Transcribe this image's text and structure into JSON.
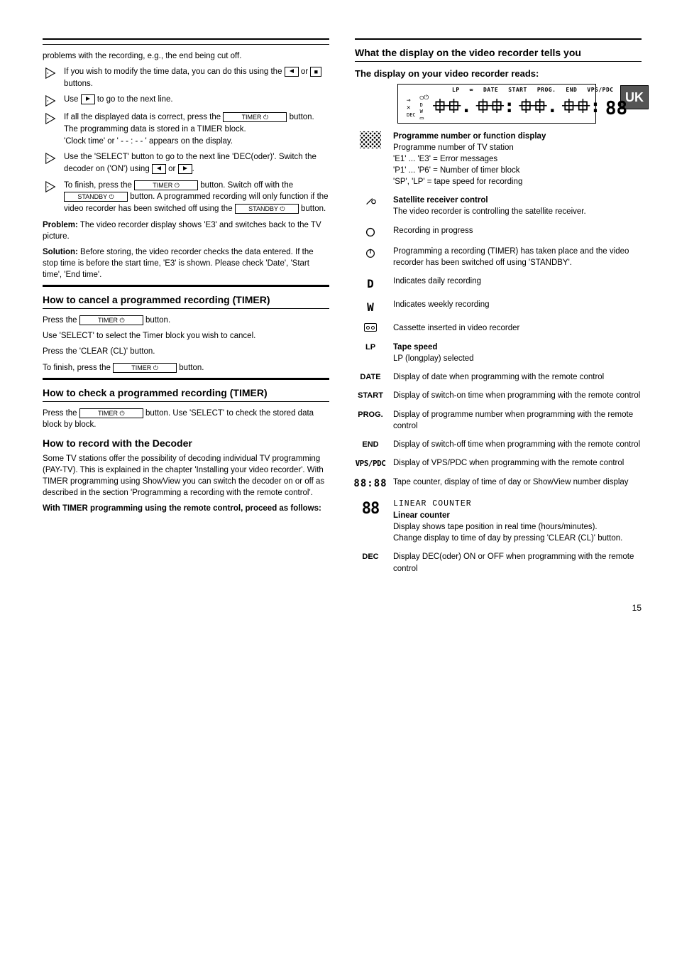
{
  "region_badge": "UK",
  "page_number": "15",
  "left": {
    "intro_continue": "problems with the recording, e.g., the end being cut off.",
    "steps": [
      {
        "title": "If you wish to modify the time data, you can do this using the ",
        "key1_label": "■",
        "title_mid": " or ",
        "key2_label": "",
        "title_end": " buttons.",
        "extra1": "",
        "extra2": "Use  to go to the next line."
      },
      {
        "title": "If all the displayed data is correct, press the ",
        "key": "TIMER ⏻",
        "title_end": " button. The programming data is stored in a TIMER block.",
        "extra": "'Clock time' or ' - - : - - ' appears on the display."
      },
      {
        "title": "Use the 'SELECT' button to go to the next line 'DEC(oder)'. Switch the decoder on ('ON') using  or .",
        "title_end": ""
      },
      {
        "title": "To finish, press the ",
        "key": "TIMER ⏻",
        "title_end": " button. Switch off with the ",
        "key2": "STANDBY ⏻",
        "title2_end": " button. A programmed recording will only function if the video recorder has been switched off using the ",
        "key3": "STANDBY ⏻",
        "title3_end": " button."
      }
    ],
    "problem_title": "Problem:",
    "problem_text": "The video recorder display shows 'E3' and switches back to the TV picture.",
    "solution_title": "Solution:",
    "solution_text": "Before storing, the video recorder checks the data entered. If the stop time is before the start time, 'E3' is shown. Please check 'Date', 'Start time', 'End time'.",
    "cancel_heading": "How to cancel a programmed recording (TIMER)",
    "cancel_steps": [
      "Press the  TIMER ⏻  button.",
      "Use 'SELECT' to select the Timer block you wish to cancel.",
      "Press the 'CLEAR (CL)' button.",
      "To finish, press the  TIMER ⏻  button."
    ],
    "check_heading": "How to check a programmed recording (TIMER)",
    "check_intro": "Press the  TIMER ⏻  button. Use 'SELECT' to check the stored data block by block.",
    "dec_heading": "How to record with the Decoder",
    "dec_text": "Some TV stations offer the possibility of decoding individual TV programming (PAY-TV). This is explained in the chapter 'Installing your video recorder'. With TIMER programming using ShowView you can switch the decoder on or off as described in the section 'Programming a recording with the remote control'.",
    "dec_steps_heading": "With TIMER programming using the remote control, proceed as follows:"
  },
  "right": {
    "display_heading": "What the display on the video recorder tells you",
    "display_sub": "The display on your video recorder reads:",
    "labels_row": [
      "LP",
      "∞",
      "DATE",
      "START",
      "PROG.",
      "END",
      "VPS/PDC"
    ],
    "items": [
      {
        "icon": "dot-grid",
        "title": "Programme number or function display",
        "lines": [
          "Programme number of TV station",
          "'E1' ... 'E3' = Error messages",
          "'P1' ... 'P6' = Number of timer block",
          "'SP', 'LP' = tape speed for recording"
        ]
      },
      {
        "icon": "sat",
        "title": "Satellite receiver control",
        "lines": [
          "The video recorder is controlling the satellite receiver."
        ]
      },
      {
        "icon": "rec-circle",
        "title": "",
        "lines": [
          "Recording in progress"
        ]
      },
      {
        "icon": "timer-circle",
        "title": "",
        "lines": [
          "Programming a recording (TIMER) has taken place and the video recorder has been switched off using 'STANDBY'."
        ]
      },
      {
        "icon": "letter-D",
        "title": "",
        "lines": [
          "Indicates daily recording"
        ]
      },
      {
        "icon": "letter-W",
        "title": "",
        "lines": [
          "Indicates weekly recording"
        ]
      },
      {
        "icon": "cassette",
        "title": "",
        "lines": [
          "Cassette inserted in video recorder"
        ]
      },
      {
        "icon": "text-LP",
        "title": "Tape speed",
        "lines": [
          "LP (longplay) selected"
        ]
      },
      {
        "icon": "text-DATE",
        "title": "",
        "lines": [
          "Display of date when programming with the remote control"
        ]
      },
      {
        "icon": "text-START",
        "title": "",
        "lines": [
          "Display of switch-on time when programming with the remote control"
        ]
      },
      {
        "icon": "text-PROG",
        "title": "",
        "lines": [
          "Display of programme number when programming with the remote control"
        ]
      },
      {
        "icon": "text-END",
        "title": "",
        "lines": [
          "Display of switch-off time when programming with the remote control"
        ]
      },
      {
        "icon": "text-VPS",
        "title": "",
        "lines": [
          "Display of VPS/PDC when programming with the remote control"
        ]
      },
      {
        "icon": "seg-time",
        "title": "",
        "lines": [
          "Tape counter, display of time of day or ShowView number display"
        ]
      },
      {
        "icon": "seg-88",
        "title": "LINEAR COUNTER",
        "title2": "Linear counter",
        "lines": [
          "Display shows tape position in real time (hours/minutes).",
          "Change display to time of day by pressing 'CLEAR (CL)' button."
        ]
      },
      {
        "icon": "text-DEC",
        "title": "",
        "lines": [
          "Display DEC(oder) ON or OFF when programming with the remote control"
        ]
      }
    ]
  }
}
